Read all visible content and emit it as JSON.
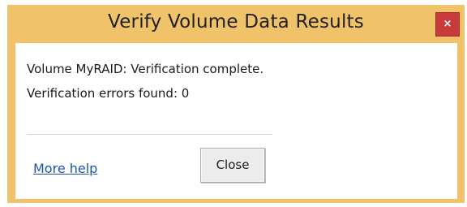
{
  "window": {
    "title": "Verify Volume Data Results",
    "close_glyph": "×",
    "frame_color": "#f0c36a",
    "close_color": "#c73b3b"
  },
  "messages": {
    "line1": "Volume MyRAID: Verification complete.",
    "line2": "Verification errors found: 0"
  },
  "footer": {
    "help_link": "More help",
    "close_button": "Close",
    "link_color": "#1a55b0"
  }
}
